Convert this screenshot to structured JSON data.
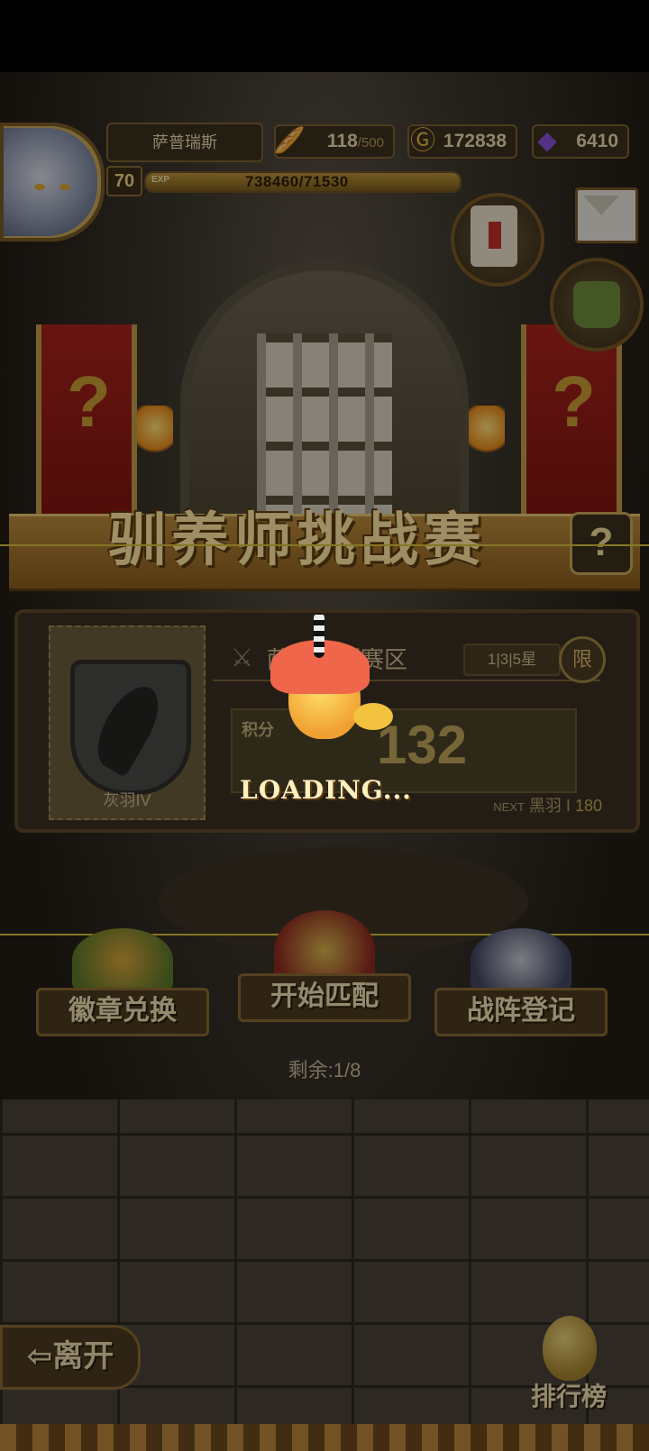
{
  "player": {
    "name": "萨普瑞斯",
    "level": "70",
    "exp_tag": "EXP",
    "exp_text": "738460/71530",
    "exp_progress": 1.0
  },
  "resources": {
    "stamina": {
      "value": "118",
      "max": "/500",
      "icon": "bread-icon"
    },
    "gold": {
      "value": "172838",
      "icon": "gold-coin-icon"
    },
    "gems": {
      "value": "6410",
      "icon": "purple-gem-icon"
    }
  },
  "title": {
    "text": "驯养师挑战赛",
    "help": "?"
  },
  "panel": {
    "rank_name": "灰羽IV",
    "zone_name": "萨普瑞斯赛区",
    "stars": "1|3|5星",
    "limit_badge": "限",
    "score_label": "积分",
    "score_value": "132",
    "next_tag": "NEXT",
    "next_rank": "黑羽 I",
    "next_score": "180"
  },
  "loading": {
    "text": "LOADING..."
  },
  "menu": {
    "badge_exchange": "徽章兑换",
    "start_match": "开始匹配",
    "formation": "战阵登记",
    "remaining": "剩余:1/8"
  },
  "bottom": {
    "leave": "⇦离开",
    "ranking": "排行榜"
  },
  "colors": {
    "accent_gold": "#d9c03a",
    "banner_red": "#a8221c"
  }
}
